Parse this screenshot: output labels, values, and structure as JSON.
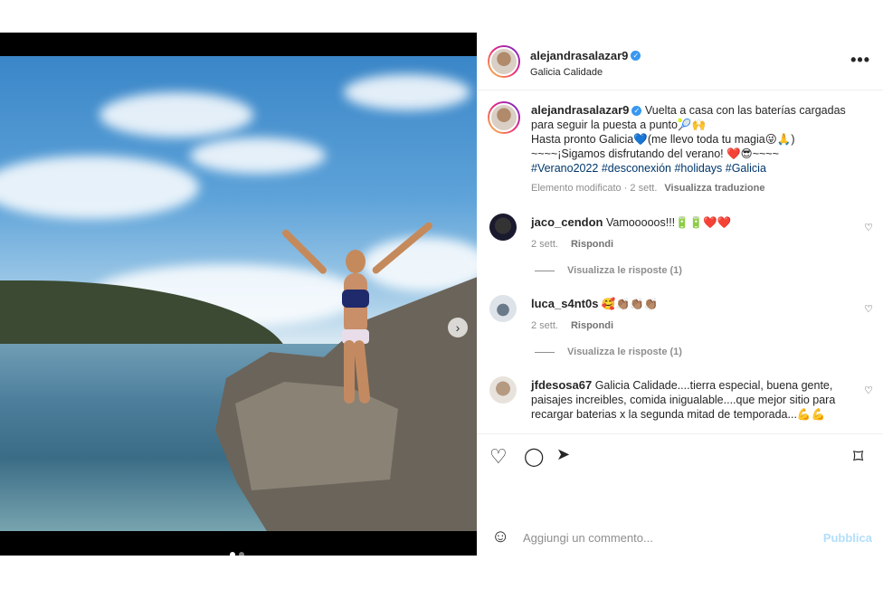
{
  "post": {
    "author": "alejandrasalazar9",
    "location": "Galicia Calidade",
    "more_icon": "•••",
    "next_icon": "›"
  },
  "caption": {
    "author": "alejandrasalazar9",
    "line1": "Vuelta a casa con las baterías cargadas para seguir la puesta a punto🎾🙌",
    "line2": "Hasta pronto Galicia💙(me llevo toda tu magia😜🙏)",
    "line3": "~~~~¡Sigamos disfrutando del verano! ❤️😎~~~~",
    "hashtags": "#Verano2022 #desconexión #holidays #Galicia",
    "edited": "Elemento modificato · 2 sett.",
    "translate": "Visualizza traduzione"
  },
  "comments": [
    {
      "user": "jaco_cendon",
      "text": "Vamooooos!!!🔋🔋❤️❤️",
      "time": "2 sett.",
      "reply": "Rispondi",
      "view_replies": "Visualizza le risposte (1)"
    },
    {
      "user": "luca_s4nt0s",
      "text": "🥰👏🏽👏🏽👏🏽",
      "time": "2 sett.",
      "reply": "Rispondi",
      "view_replies": "Visualizza le risposte (1)"
    },
    {
      "user": "jfdesosa67",
      "text": "Galicia Calidade....tierra especial, buena gente, paisajes increibles, comida inigualable....que mejor sitio para recargar baterias x la segunda mitad de temporada...💪💪"
    }
  ],
  "actions": {
    "like": "♡",
    "comment": "◯",
    "share": "➤",
    "save": "⌑"
  },
  "add_comment": {
    "placeholder": "Aggiungi un commento...",
    "publish": "Pubblica",
    "emoji": "☺"
  },
  "colors": {
    "accent": "#0095f6",
    "publish_disabled": "#b2dffc",
    "hashtag": "#00376b"
  }
}
